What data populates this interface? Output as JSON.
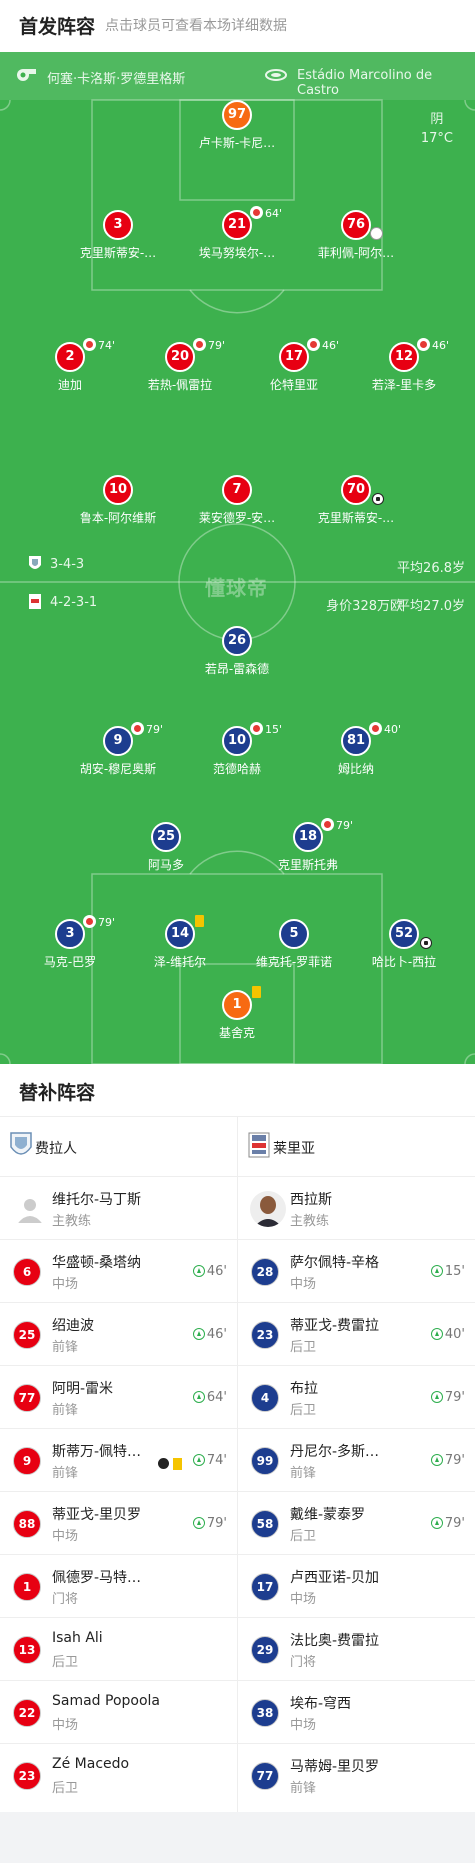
{
  "header": {
    "title": "首发阵容",
    "subtitle": "点击球员可查看本场详细数据"
  },
  "pitch": {
    "home_team": "何塞·卡洛斯·罗德里格斯",
    "away_team": "Estádio Marcolino de Castro",
    "weather": "阴",
    "temperature": "17°C",
    "watermark": "懂球帝",
    "home_formation": "3-4-3",
    "home_avg_age": "平均26.8岁",
    "away_formation": "4-2-3-1",
    "away_value": "身价328万欧",
    "away_avg_age": "平均27.0岁",
    "colors": {
      "home": "#e70012",
      "away": "#1d3d8f",
      "keeper": "#f76a12",
      "grass": "#3db14e"
    },
    "home_players": [
      {
        "num": "97",
        "name": "卢卡斯-卡尼…",
        "kit": "o"
      },
      {
        "num": "3",
        "name": "克里斯蒂安-…",
        "kit": "r"
      },
      {
        "num": "21",
        "name": "埃马努埃尔-…",
        "kit": "r",
        "sub": "64'"
      },
      {
        "num": "76",
        "name": "菲利佩-阿尔…",
        "kit": "r",
        "own": true
      },
      {
        "num": "2",
        "name": "迪加",
        "kit": "r",
        "sub": "74'"
      },
      {
        "num": "20",
        "name": "若热-佩雷拉",
        "kit": "r",
        "sub": "79'"
      },
      {
        "num": "17",
        "name": "伦特里亚",
        "kit": "r",
        "sub": "46'"
      },
      {
        "num": "12",
        "name": "若泽-里卡多",
        "kit": "r",
        "sub": "46'"
      },
      {
        "num": "10",
        "name": "鲁本-阿尔维斯",
        "kit": "r"
      },
      {
        "num": "7",
        "name": "莱安德罗-安…",
        "kit": "r"
      },
      {
        "num": "70",
        "name": "克里斯蒂安-…",
        "kit": "r",
        "goal": true
      }
    ],
    "away_players": [
      {
        "num": "26",
        "name": "若昂-雷森德",
        "kit": "b"
      },
      {
        "num": "9",
        "name": "胡安-穆尼奥斯",
        "kit": "b",
        "sub": "79'"
      },
      {
        "num": "10",
        "name": "范德哈赫",
        "kit": "b",
        "sub": "15'"
      },
      {
        "num": "81",
        "name": "姆比纳",
        "kit": "b",
        "sub": "40'"
      },
      {
        "num": "25",
        "name": "阿马多",
        "kit": "b"
      },
      {
        "num": "18",
        "name": "克里斯托弗",
        "kit": "b",
        "sub": "79'"
      },
      {
        "num": "3",
        "name": "马克-巴罗",
        "kit": "b",
        "sub": "79'"
      },
      {
        "num": "14",
        "name": "泽-维托尔",
        "kit": "b",
        "yellow": true
      },
      {
        "num": "5",
        "name": "维克托-罗菲诺",
        "kit": "b"
      },
      {
        "num": "52",
        "name": "哈比卜-西拉",
        "kit": "b",
        "goal": true
      },
      {
        "num": "1",
        "name": "基舍克",
        "kit": "o",
        "yellow": true
      }
    ]
  },
  "bench": {
    "title": "替补阵容",
    "home": {
      "team": "费拉人",
      "coach_name": "维托尔-马丁斯",
      "coach_role": "主教练",
      "players": [
        {
          "num": "6",
          "name": "华盛顿-桑塔纳",
          "pos": "中场",
          "time": "46'"
        },
        {
          "num": "25",
          "name": "绍迪波",
          "pos": "前锋",
          "time": "46'"
        },
        {
          "num": "77",
          "name": "阿明-雷米",
          "pos": "前锋",
          "time": "64'"
        },
        {
          "num": "9",
          "name": "斯蒂万-佩特…",
          "pos": "前锋",
          "time": "74'",
          "events": true
        },
        {
          "num": "88",
          "name": "蒂亚戈-里贝罗",
          "pos": "中场",
          "time": "79'"
        },
        {
          "num": "1",
          "name": "佩德罗-马特…",
          "pos": "门将",
          "time": ""
        },
        {
          "num": "13",
          "name": "Isah Ali",
          "pos": "后卫",
          "time": ""
        },
        {
          "num": "22",
          "name": "Samad Popoola",
          "pos": "中场",
          "time": ""
        },
        {
          "num": "23",
          "name": "Zé Macedo",
          "pos": "后卫",
          "time": ""
        }
      ]
    },
    "away": {
      "team": "莱里亚",
      "coach_name": "西拉斯",
      "coach_role": "主教练",
      "players": [
        {
          "num": "28",
          "name": "萨尔佩特-辛格",
          "pos": "中场",
          "time": "15'"
        },
        {
          "num": "23",
          "name": "蒂亚戈-费雷拉",
          "pos": "后卫",
          "time": "40'"
        },
        {
          "num": "4",
          "name": "布拉",
          "pos": "后卫",
          "time": "79'"
        },
        {
          "num": "99",
          "name": "丹尼尔-多斯…",
          "pos": "前锋",
          "time": "79'"
        },
        {
          "num": "58",
          "name": "戴维-蒙泰罗",
          "pos": "后卫",
          "time": "79'"
        },
        {
          "num": "17",
          "name": "卢西亚诺-贝加",
          "pos": "中场",
          "time": ""
        },
        {
          "num": "29",
          "name": "法比奥-费雷拉",
          "pos": "门将",
          "time": ""
        },
        {
          "num": "38",
          "name": "埃布-穹西",
          "pos": "中场",
          "time": ""
        },
        {
          "num": "77",
          "name": "马蒂姆-里贝罗",
          "pos": "前锋",
          "time": ""
        }
      ]
    }
  }
}
